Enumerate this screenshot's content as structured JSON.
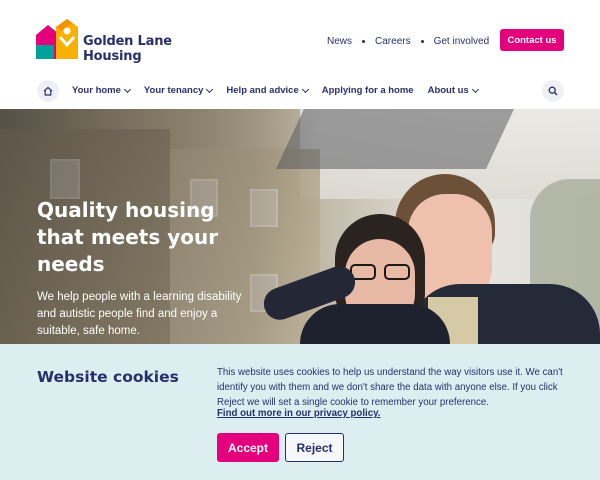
{
  "brand": {
    "name_line1": "Golden Lane",
    "name_line2": "Housing",
    "colors": {
      "navy": "#2a2f6b",
      "magenta": "#e4007c",
      "orange": "#f39200",
      "teal": "#00a19a",
      "yellow": "#f9b000"
    }
  },
  "top_links": [
    {
      "label": "News"
    },
    {
      "label": "Careers"
    },
    {
      "label": "Get involved"
    }
  ],
  "contact_label": "Contact us",
  "nav": {
    "home_icon": "home-icon",
    "search_icon": "search-icon",
    "items": [
      {
        "label": "Your home",
        "has_dropdown": true
      },
      {
        "label": "Your tenancy",
        "has_dropdown": true
      },
      {
        "label": "Help and advice",
        "has_dropdown": true
      },
      {
        "label": "Applying for a home",
        "has_dropdown": false
      },
      {
        "label": "About us",
        "has_dropdown": true
      }
    ]
  },
  "hero": {
    "title": "Quality housing that meets your needs",
    "subtitle": "We help people with a learning disability and autistic people find and enjoy a suitable, safe home."
  },
  "cookie_banner": {
    "title": "Website cookies",
    "text": "This website uses cookies to help us understand the way visitors use it. We can't identify you with them and we don't share the data with anyone else. If you click Reject we will set a single cookie to remember your preference.",
    "link_label": "Find out more in our privacy policy.",
    "accept_label": "Accept",
    "reject_label": "Reject"
  }
}
